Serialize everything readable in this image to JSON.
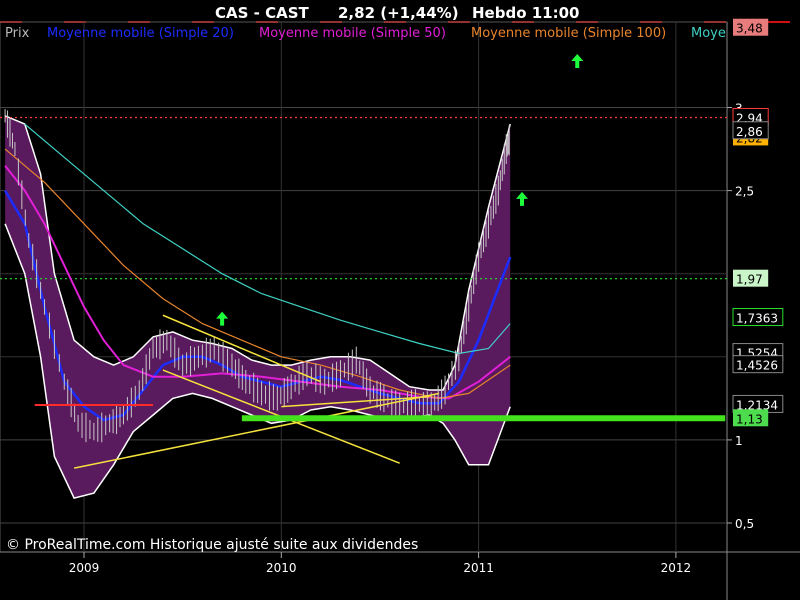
{
  "header": {
    "symbol": "CAS - CAST",
    "price_change": "2,82 (+1,44%)",
    "timeframe": "Hebdo  11:00"
  },
  "legend": [
    {
      "label": "Prix",
      "color": "#b9b9b9"
    },
    {
      "label": "Moyenne mobile (Simple 20)",
      "color": "#1c2cff"
    },
    {
      "label": "Moyenne mobile (Simple 50)",
      "color": "#e11fd6"
    },
    {
      "label": "Moyenne mobile (Simple 100)",
      "color": "#e8842c"
    },
    {
      "label": "Moye",
      "color": "#3fd1c4"
    }
  ],
  "footer": "© ProRealTime.com Historique ajusté suite aux dividendes",
  "colors": {
    "background": "#000000",
    "band_fill": "#5a1a5e",
    "band_edge": "#ffffff",
    "price": "#c8c8c8",
    "ma20": "#1c2cff",
    "ma50": "#e11fd6",
    "ma100": "#e8842c",
    "ma200": "#3fd1c4",
    "trendline": "#f5e23c",
    "support": "#43e21c",
    "resistance": "#ff2a2a",
    "arrow": "#1cff3a",
    "axis_text": "#ffffff",
    "gridline": "#444444"
  },
  "chart_data": {
    "type": "line",
    "title": "CAS - CAST",
    "ylim": [
      0.5,
      3.48
    ],
    "x_ticks": [
      "2009",
      "2010",
      "2011",
      "2012"
    ],
    "y_ticks": [
      "0,5",
      "1",
      "2,5",
      "3"
    ],
    "price_tags": [
      {
        "label": "3,48",
        "value": 3.48,
        "bg": "#e87c7c",
        "fg": "#000000"
      },
      {
        "label": "2,94",
        "value": 2.94,
        "bg": "#000000",
        "fg": "#ffffff",
        "border": "#ff3b3b"
      },
      {
        "label": "2,82",
        "value": 2.82,
        "bg": "#ffb300",
        "fg": "#000000"
      },
      {
        "label": "2,86",
        "value": 2.86,
        "bg": "#000000",
        "fg": "#ffffff",
        "border": "#888888"
      },
      {
        "label": "1,97",
        "value": 1.97,
        "bg": "#c9f5c9",
        "fg": "#000000"
      },
      {
        "label": "1,7363",
        "value": 1.7363,
        "bg": "#000000",
        "fg": "#ffffff",
        "border": "#2ae02a"
      },
      {
        "label": "1,5254",
        "value": 1.5254,
        "bg": "#000000",
        "fg": "#ffffff",
        "border": "#888888"
      },
      {
        "label": "1,4526",
        "value": 1.4526,
        "bg": "#000000",
        "fg": "#ffffff",
        "border": "#888888"
      },
      {
        "label": "1,2134",
        "value": 1.2134,
        "bg": "#000000",
        "fg": "#ffffff",
        "border": "#888888"
      },
      {
        "label": "1,13",
        "value": 1.13,
        "bg": "#4ddc4d",
        "fg": "#000000"
      }
    ],
    "horizontal_levels": [
      {
        "value": 2.94,
        "style": "dotted",
        "color": "#ff3b3b"
      },
      {
        "value": 1.97,
        "style": "dotted",
        "color": "#2ae02a"
      },
      {
        "value": 1.13,
        "style": "solid-thick",
        "color": "#43e21c"
      }
    ],
    "series": [
      {
        "key": "price",
        "points": [
          [
            2008.6,
            2.95
          ],
          [
            2008.65,
            2.75
          ],
          [
            2008.72,
            2.2
          ],
          [
            2008.8,
            1.8
          ],
          [
            2008.9,
            1.35
          ],
          [
            2008.97,
            1.1
          ],
          [
            2009.05,
            1.05
          ],
          [
            2009.13,
            1.1
          ],
          [
            2009.2,
            1.15
          ],
          [
            2009.28,
            1.3
          ],
          [
            2009.35,
            1.55
          ],
          [
            2009.42,
            1.6
          ],
          [
            2009.5,
            1.45
          ],
          [
            2009.58,
            1.5
          ],
          [
            2009.66,
            1.55
          ],
          [
            2009.75,
            1.45
          ],
          [
            2009.82,
            1.35
          ],
          [
            2009.9,
            1.28
          ],
          [
            2009.98,
            1.25
          ],
          [
            2010.05,
            1.32
          ],
          [
            2010.13,
            1.4
          ],
          [
            2010.22,
            1.35
          ],
          [
            2010.3,
            1.4
          ],
          [
            2010.38,
            1.48
          ],
          [
            2010.45,
            1.3
          ],
          [
            2010.52,
            1.25
          ],
          [
            2010.6,
            1.2
          ],
          [
            2010.68,
            1.22
          ],
          [
            2010.76,
            1.2
          ],
          [
            2010.83,
            1.3
          ],
          [
            2010.9,
            1.5
          ],
          [
            2010.95,
            1.8
          ],
          [
            2011.0,
            2.1
          ],
          [
            2011.05,
            2.3
          ],
          [
            2011.1,
            2.5
          ],
          [
            2011.14,
            2.75
          ],
          [
            2011.16,
            2.82
          ]
        ]
      },
      {
        "key": "ma20",
        "points": [
          [
            2008.6,
            2.5
          ],
          [
            2008.7,
            2.3
          ],
          [
            2008.8,
            1.8
          ],
          [
            2008.9,
            1.35
          ],
          [
            2009.0,
            1.2
          ],
          [
            2009.1,
            1.12
          ],
          [
            2009.2,
            1.15
          ],
          [
            2009.3,
            1.3
          ],
          [
            2009.4,
            1.45
          ],
          [
            2009.5,
            1.5
          ],
          [
            2009.6,
            1.5
          ],
          [
            2009.7,
            1.45
          ],
          [
            2009.8,
            1.38
          ],
          [
            2009.9,
            1.35
          ],
          [
            2010.0,
            1.32
          ],
          [
            2010.1,
            1.35
          ],
          [
            2010.2,
            1.38
          ],
          [
            2010.3,
            1.36
          ],
          [
            2010.4,
            1.32
          ],
          [
            2010.5,
            1.28
          ],
          [
            2010.6,
            1.25
          ],
          [
            2010.7,
            1.22
          ],
          [
            2010.8,
            1.22
          ],
          [
            2010.9,
            1.35
          ],
          [
            2011.0,
            1.6
          ],
          [
            2011.08,
            1.85
          ],
          [
            2011.16,
            2.1
          ]
        ]
      },
      {
        "key": "ma50",
        "points": [
          [
            2008.6,
            2.65
          ],
          [
            2008.7,
            2.5
          ],
          [
            2008.8,
            2.3
          ],
          [
            2008.9,
            2.05
          ],
          [
            2009.0,
            1.8
          ],
          [
            2009.1,
            1.6
          ],
          [
            2009.2,
            1.45
          ],
          [
            2009.35,
            1.38
          ],
          [
            2009.5,
            1.38
          ],
          [
            2009.7,
            1.4
          ],
          [
            2009.9,
            1.38
          ],
          [
            2010.1,
            1.35
          ],
          [
            2010.3,
            1.32
          ],
          [
            2010.5,
            1.3
          ],
          [
            2010.7,
            1.26
          ],
          [
            2010.85,
            1.25
          ],
          [
            2011.0,
            1.35
          ],
          [
            2011.16,
            1.5
          ]
        ]
      },
      {
        "key": "ma100",
        "points": [
          [
            2008.6,
            2.75
          ],
          [
            2008.8,
            2.55
          ],
          [
            2009.0,
            2.3
          ],
          [
            2009.2,
            2.05
          ],
          [
            2009.4,
            1.85
          ],
          [
            2009.6,
            1.7
          ],
          [
            2009.8,
            1.6
          ],
          [
            2010.0,
            1.5
          ],
          [
            2010.2,
            1.45
          ],
          [
            2010.4,
            1.38
          ],
          [
            2010.6,
            1.3
          ],
          [
            2010.8,
            1.25
          ],
          [
            2010.95,
            1.28
          ],
          [
            2011.16,
            1.45
          ]
        ]
      },
      {
        "key": "ma200",
        "points": [
          [
            2008.7,
            2.9
          ],
          [
            2008.9,
            2.7
          ],
          [
            2009.1,
            2.5
          ],
          [
            2009.3,
            2.3
          ],
          [
            2009.5,
            2.15
          ],
          [
            2009.7,
            2.0
          ],
          [
            2009.9,
            1.88
          ],
          [
            2010.1,
            1.8
          ],
          [
            2010.3,
            1.72
          ],
          [
            2010.5,
            1.65
          ],
          [
            2010.7,
            1.58
          ],
          [
            2010.9,
            1.52
          ],
          [
            2011.05,
            1.55
          ],
          [
            2011.16,
            1.7
          ]
        ]
      }
    ],
    "band_upper": [
      [
        2008.6,
        2.95
      ],
      [
        2008.7,
        2.9
      ],
      [
        2008.78,
        2.6
      ],
      [
        2008.85,
        2.0
      ],
      [
        2008.95,
        1.6
      ],
      [
        2009.05,
        1.5
      ],
      [
        2009.15,
        1.45
      ],
      [
        2009.25,
        1.5
      ],
      [
        2009.35,
        1.62
      ],
      [
        2009.45,
        1.65
      ],
      [
        2009.55,
        1.6
      ],
      [
        2009.65,
        1.58
      ],
      [
        2009.75,
        1.55
      ],
      [
        2009.85,
        1.48
      ],
      [
        2009.95,
        1.45
      ],
      [
        2010.05,
        1.45
      ],
      [
        2010.15,
        1.48
      ],
      [
        2010.25,
        1.5
      ],
      [
        2010.35,
        1.5
      ],
      [
        2010.45,
        1.48
      ],
      [
        2010.55,
        1.4
      ],
      [
        2010.65,
        1.32
      ],
      [
        2010.75,
        1.3
      ],
      [
        2010.82,
        1.3
      ],
      [
        2010.88,
        1.45
      ],
      [
        2010.95,
        1.9
      ],
      [
        2011.05,
        2.4
      ],
      [
        2011.16,
        2.9
      ]
    ],
    "band_lower": [
      [
        2008.6,
        2.3
      ],
      [
        2008.7,
        2.0
      ],
      [
        2008.78,
        1.5
      ],
      [
        2008.85,
        0.9
      ],
      [
        2008.95,
        0.65
      ],
      [
        2009.05,
        0.68
      ],
      [
        2009.15,
        0.85
      ],
      [
        2009.25,
        1.05
      ],
      [
        2009.35,
        1.15
      ],
      [
        2009.45,
        1.25
      ],
      [
        2009.55,
        1.28
      ],
      [
        2009.65,
        1.25
      ],
      [
        2009.75,
        1.2
      ],
      [
        2009.85,
        1.15
      ],
      [
        2009.95,
        1.1
      ],
      [
        2010.05,
        1.12
      ],
      [
        2010.15,
        1.18
      ],
      [
        2010.25,
        1.2
      ],
      [
        2010.35,
        1.18
      ],
      [
        2010.45,
        1.15
      ],
      [
        2010.55,
        1.12
      ],
      [
        2010.65,
        1.13
      ],
      [
        2010.75,
        1.15
      ],
      [
        2010.82,
        1.1
      ],
      [
        2010.88,
        1.0
      ],
      [
        2010.95,
        0.85
      ],
      [
        2011.05,
        0.85
      ],
      [
        2011.16,
        1.2
      ]
    ],
    "trendlines": [
      {
        "from": [
          2008.95,
          0.83
        ],
        "to": [
          2010.8,
          1.28
        ],
        "color": "#f5e23c"
      },
      {
        "from": [
          2009.4,
          1.75
        ],
        "to": [
          2010.2,
          1.35
        ],
        "color": "#f5e23c"
      },
      {
        "from": [
          2009.4,
          1.42
        ],
        "to": [
          2010.6,
          0.86
        ],
        "color": "#f5e23c"
      },
      {
        "from": [
          2010.0,
          1.2
        ],
        "to": [
          2010.75,
          1.26
        ],
        "color": "#f5e23c"
      }
    ],
    "resistance_segments": [
      {
        "from": [
          2008.75,
          1.21
        ],
        "to": [
          2009.35,
          1.21
        ],
        "color": "#ff2a2a"
      }
    ],
    "support_segment": {
      "from": [
        2009.8,
        1.13
      ],
      "to": [
        2012.25,
        1.13
      ],
      "color": "#43e21c"
    },
    "arrows": [
      {
        "x": 2009.7,
        "y": 1.73
      },
      {
        "x": 2011.22,
        "y": 2.45
      },
      {
        "x": 2011.5,
        "y": 3.28
      }
    ]
  }
}
